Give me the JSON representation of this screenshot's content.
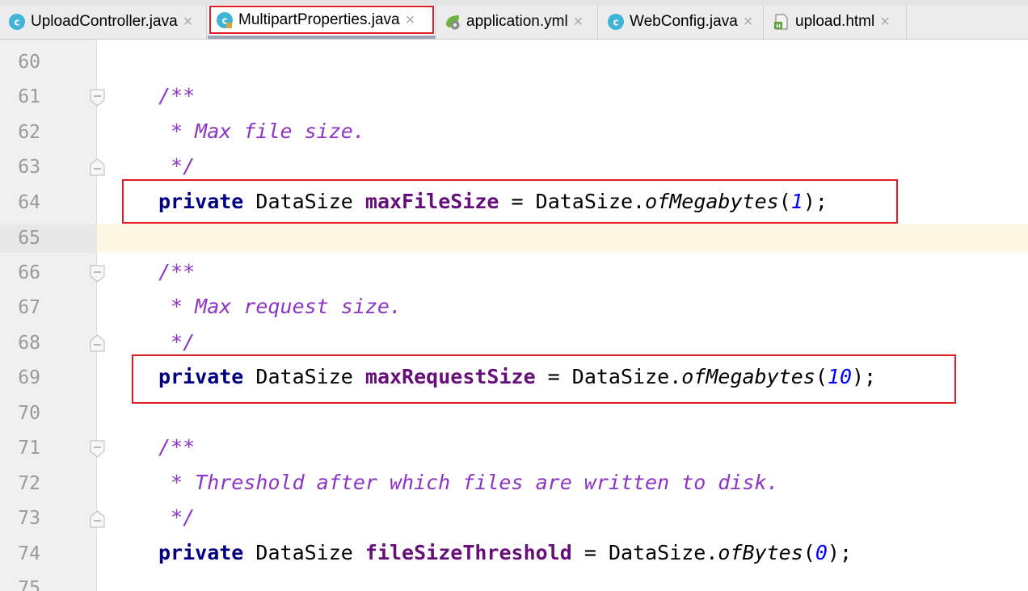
{
  "tabs": [
    {
      "label": "UploadController.java",
      "icon": "java-class-icon",
      "active": false
    },
    {
      "label": "MultipartProperties.java",
      "icon": "java-class-icon",
      "active": true
    },
    {
      "label": "application.yml",
      "icon": "spring-config-icon",
      "active": false
    },
    {
      "label": "WebConfig.java",
      "icon": "java-class-icon",
      "active": false
    },
    {
      "label": "upload.html",
      "icon": "html-file-icon",
      "active": false
    }
  ],
  "close_glyph": "×",
  "line_numbers": [
    "60",
    "61",
    "62",
    "63",
    "64",
    "65",
    "66",
    "67",
    "68",
    "69",
    "70",
    "71",
    "72",
    "73",
    "74",
    "75"
  ],
  "code": {
    "l61": "/**",
    "l62": " * Max file size.",
    "l63": " */",
    "l64": {
      "kw": "private",
      "type": "DataSize",
      "field": "maxFileSize",
      "eq": " = ",
      "cls": "DataSize.",
      "method": "ofMegabytes",
      "open": "(",
      "arg": "1",
      "close": ");"
    },
    "l66": "/**",
    "l67": " * Max request size.",
    "l68": " */",
    "l69": {
      "kw": "private",
      "type": "DataSize",
      "field": "maxRequestSize",
      "eq": " = ",
      "cls": "DataSize.",
      "method": "ofMegabytes",
      "open": "(",
      "arg": "10",
      "close": ");"
    },
    "l71": "/**",
    "l72": " * Threshold after which files are written to disk.",
    "l73": " */",
    "l74": {
      "kw": "private",
      "type": "DataSize",
      "field": "fileSizeThreshold",
      "eq": " = ",
      "cls": "DataSize.",
      "method": "ofBytes",
      "open": "(",
      "arg": "0",
      "close": ");"
    }
  },
  "colors": {
    "highlight_box": "#e01b24",
    "comment": "#8c35c4",
    "keyword": "#000080",
    "field": "#660e7a",
    "number": "#0000ff",
    "caret_line": "#fdf7e1"
  }
}
